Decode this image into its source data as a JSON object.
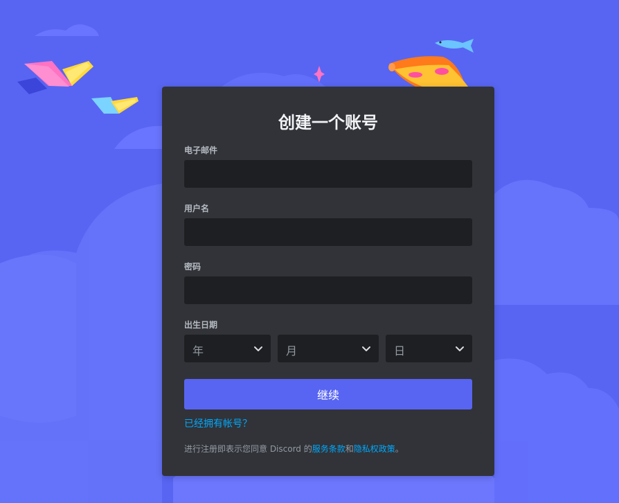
{
  "form": {
    "title": "创建一个账号",
    "email_label": "电子邮件",
    "email_value": "",
    "username_label": "用户名",
    "username_value": "",
    "password_label": "密码",
    "password_value": "",
    "dob_label": "出生日期",
    "year_placeholder": "年",
    "month_placeholder": "月",
    "day_placeholder": "日",
    "continue_label": "继续",
    "login_link": "已经拥有帐号？",
    "terms_prefix": "进行注册即表示您同意 Discord 的",
    "terms_of_service": "服务条款",
    "terms_and": "和",
    "privacy_policy": "隐私权政策",
    "terms_suffix": "。"
  },
  "theme": {
    "background": "#5865f2",
    "card": "#313338",
    "input": "#1e1f22",
    "button": "#5865f2",
    "link": "#00a8fc"
  },
  "icons": [
    "chevron-down-icon"
  ]
}
